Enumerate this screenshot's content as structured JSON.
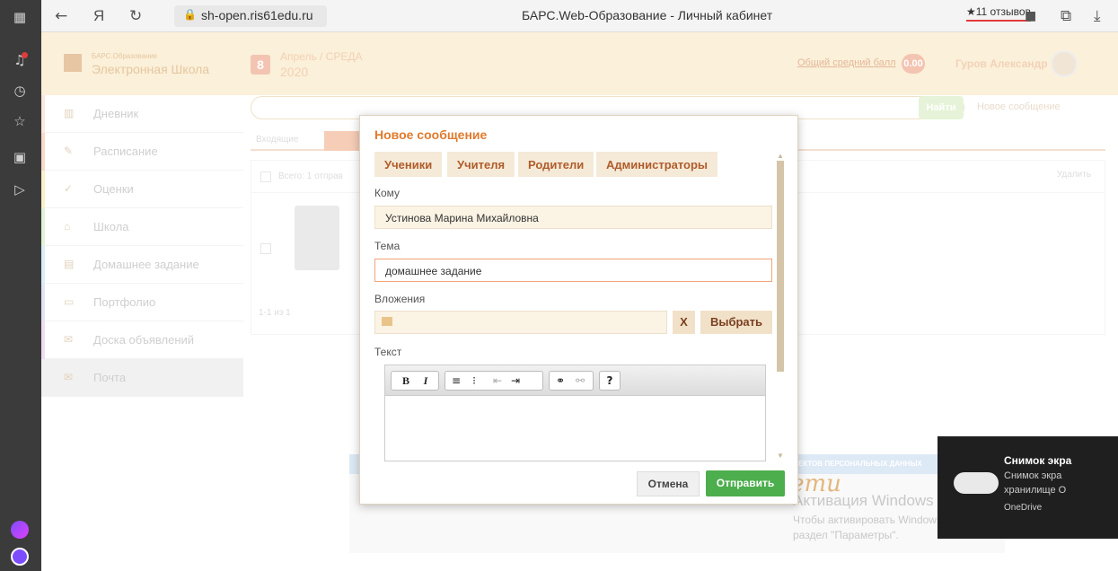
{
  "browser": {
    "url": "sh-open.ris61edu.ru",
    "tab_title": "БАРС.Web-Образование - Личный кабинет",
    "reviews": "★11 отзывов"
  },
  "header": {
    "logo_top": "БАРС.Образование",
    "logo_main": "Электронная Школа",
    "day": "8",
    "month": "Апрель / СРЕДА",
    "year": "2020",
    "avg_label": "Общий средний балл",
    "avg_value": "0.00",
    "user": "Гуров Александр"
  },
  "sidebar": {
    "items": [
      {
        "label": "Дневник",
        "icon": "diary-icon"
      },
      {
        "label": "Расписание",
        "icon": "schedule-icon"
      },
      {
        "label": "Оценки",
        "icon": "grades-icon"
      },
      {
        "label": "Школа",
        "icon": "school-icon"
      },
      {
        "label": "Домашнее задание",
        "icon": "homework-icon"
      },
      {
        "label": "Портфолио",
        "icon": "portfolio-icon"
      },
      {
        "label": "Доска объявлений",
        "icon": "board-icon"
      },
      {
        "label": "Почта",
        "icon": "mail-icon"
      }
    ]
  },
  "mail": {
    "find": "Найти",
    "new_message": "Новое сообщение",
    "tab_incoming": "Входящие",
    "tab_outgoing": "Исх",
    "total": "Всего: 1 отправ",
    "delete": "Удалить",
    "pager": "1-1 из 1"
  },
  "modal": {
    "title": "Новое сообщение",
    "role_tabs": [
      "Ученики",
      "Учителя",
      "Родители",
      "Администраторы"
    ],
    "to_label": "Кому",
    "to_value": "Устинова Марина Михайловна",
    "subject_label": "Тема",
    "subject_value": "домашнее задание",
    "attach_label": "Вложения",
    "clear": "X",
    "choose": "Выбрать",
    "text_label": "Текст",
    "toolbar": [
      "B",
      "I",
      "?"
    ],
    "cancel": "Отмена",
    "send": "Отправить"
  },
  "banner": {
    "text": "ЕКТОВ ПЕРСОНАЛЬНЫХ ДАННЫХ",
    "deti": "е.деmи"
  },
  "activation": {
    "line1": "Активация Windows",
    "line2": "Чтобы активировать Windows, перейдите в",
    "line3": "раздел \"Параметры\"."
  },
  "toast": {
    "title": "Снимок экра",
    "line1": "Снимок экра",
    "line2": "хранилище О",
    "source": "OneDrive"
  }
}
